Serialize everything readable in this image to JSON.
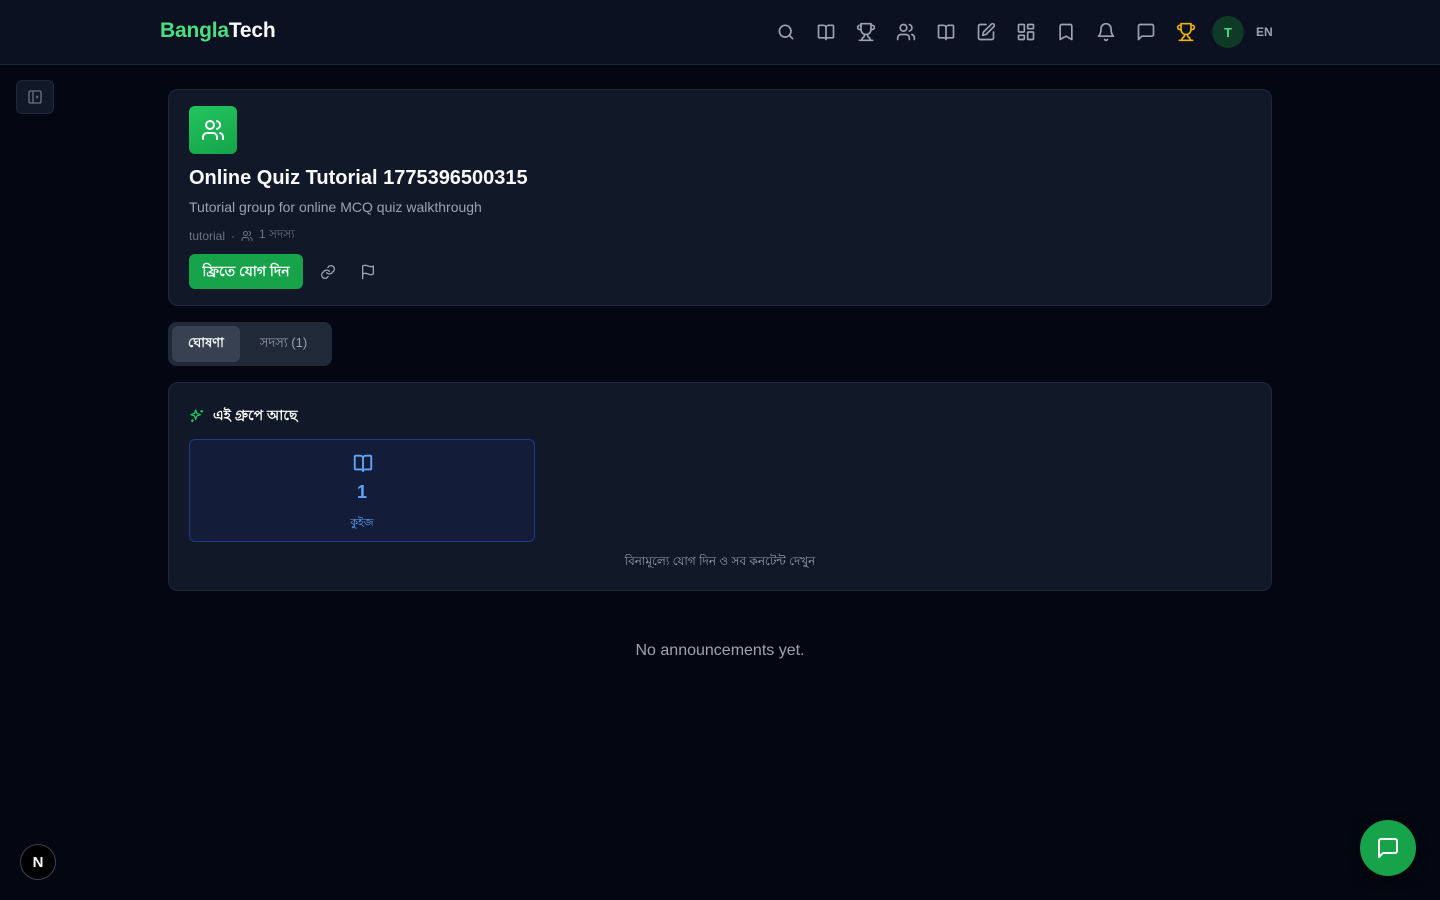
{
  "brand": {
    "part1": "Bangla",
    "part2": "Tech"
  },
  "nav": {
    "icons": [
      "search-icon",
      "book-open-icon",
      "trophy-icon",
      "users-icon",
      "book-open-icon",
      "pencil-square-icon",
      "grid-icon",
      "bookmark-icon",
      "bell-icon",
      "chat-icon",
      "trophy-icon"
    ],
    "avatar_initial": "T",
    "language": "EN",
    "highlight_color": "#eab308"
  },
  "group": {
    "title": "Online Quiz Tutorial 1775396500315",
    "description": "Tutorial group for online MCQ quiz walkthrough",
    "category": "tutorial",
    "separator": "·",
    "members": "1 সদস্য",
    "join_label": "ফ্রিতে যোগ দিন",
    "accent_color": "#16a34a"
  },
  "tabs": [
    {
      "label": "ঘোষণা",
      "active": true
    },
    {
      "label": "সদস্য (1)",
      "active": false
    }
  ],
  "contents": {
    "title": "এই গ্রুপে আছে",
    "stat": {
      "value": "1",
      "label": "কুইজ"
    },
    "join_hint": "বিনামূল্যে যোগ দিন ও সব কনটেন্ট দেখুন"
  },
  "announcements": {
    "empty_text": "No announcements yet."
  },
  "next_badge": "N"
}
